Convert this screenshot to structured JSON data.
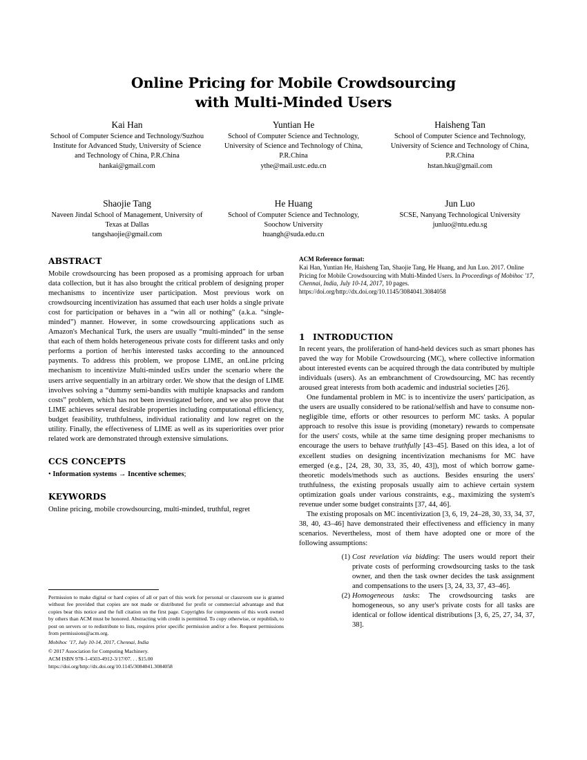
{
  "paper": {
    "title_lines": [
      "Online Pricing for Mobile Crowdsourcing",
      "with Multi-Minded Users"
    ],
    "authors_row1": [
      {
        "name": "Kai Han",
        "affiliation": "School of Computer Science and Technology/Suzhou Institute for Advanced Study, University of Science and Technology of China, P.R.China",
        "email": "hankai@gmail.com"
      },
      {
        "name": "Yuntian He",
        "affiliation": "School of Computer Science and Technology, University of Science and Technology of China, P.R.China",
        "email": "ythe@mail.ustc.edu.cn"
      },
      {
        "name": "Haisheng Tan",
        "affiliation": "School of Computer Science and Technology, University of Science and Technology of China, P.R.China",
        "email": "hstan.hku@gmail.com"
      }
    ],
    "authors_row2": [
      {
        "name": "Shaojie Tang",
        "affiliation": "Naveen Jindal School of Management, University of Texas at Dallas",
        "email": "tangshaojie@gmail.com"
      },
      {
        "name": "He Huang",
        "affiliation": "School of Computer Science and Technology, Soochow University",
        "email": "huangh@suda.edu.cn"
      },
      {
        "name": "Jun Luo",
        "affiliation": "SCSE, Nanyang Technological University",
        "email": "junluo@ntu.edu.sg"
      }
    ],
    "abstract": {
      "heading": "ABSTRACT",
      "text": "Mobile crowdsourcing has been proposed as a promising approach for urban data collection, but it has also brought the critical problem of designing proper mechanisms to incentivize user participation. Most previous work on crowdsourcing incentivization has assumed that each user holds a single private cost for participation or behaves in a “win all or nothing” (a.k.a. “single-minded”) manner. However, in some crowdsourcing applications such as Amazon's Mechanical Turk, the users are usually “multi-minded” in the sense that each of them holds heterogeneous private costs for different tasks and only performs a portion of her/his interested tasks according to the announced payments. To address this problem, we propose LIME, an onLine prIcing mechanism to incentivize Multi-minded usErs under the scenario where the users arrive sequentially in an arbitrary order. We show that the design of LIME involves solving a “dummy semi-bandits with multiple knapsacks and random costs” problem, which has not been investigated before, and we also prove that LIME achieves several desirable properties including computational efficiency, budget feasibility, truthfulness, individual rationality and low regret on the utility. Finally, the effectiveness of LIME as well as its superiorities over prior related work are demonstrated through extensive simulations."
    },
    "ccs": {
      "heading": "CCS CONCEPTS",
      "bullet": "•",
      "term1": "Information systems",
      "arrow": "→",
      "term2": "Incentive schemes",
      "trailing": ";"
    },
    "keywords": {
      "heading": "KEYWORDS",
      "text": "Online pricing, mobile crowdsourcing, multi-minded, truthful, regret"
    },
    "footnote": {
      "permission": "Permission to make digital or hard copies of all or part of this work for personal or classroom use is granted without fee provided that copies are not made or distributed for profit or commercial advantage and that copies bear this notice and the full citation on the first page. Copyrights for components of this work owned by others than ACM must be honored. Abstracting with credit is permitted. To copy otherwise, or republish, to post on servers or to redistribute to lists, requires prior specific permission and/or a fee. Request permissions from permissions@acm.org.",
      "conference": "Mobihoc ’17, July 10-14, 2017, Chennai, India",
      "copyright": "© 2017 Association for Computing Machinery.",
      "isbn": "ACM ISBN 978-1-4503-4912-3/17/07. . . $15.00",
      "doi": "https://doi.org/http://dx.doi.org/10.1145/3084041.3084058"
    },
    "acm_reference": {
      "heading": "ACM Reference format:",
      "line1": "Kai Han, Yuntian He, Haisheng Tan, Shaojie Tang, He Huang, and Jun Luo. 2017. Online Pricing for Mobile Crowdsourcing with Multi-Minded Users. In ",
      "italic_part": "Proceedings of Mobihoc '17, Chennai, India, July 10-14, 2017,",
      "line2": " 10 pages.",
      "doi": "https://doi.org/http://dx.doi.org/10.1145/3084041.3084058"
    },
    "introduction": {
      "number": "1",
      "heading": "INTRODUCTION",
      "para1": "In recent years, the proliferation of hand-held devices such as smart phones has paved the way for Mobile Crowdsourcing (MC), where collective information about interested events can be acquired through the data contributed by multiple individuals (users). As an embranchment of Crowdsourcing, MC has recently aroused great interests from both academic and industrial societies [26].",
      "para2_a": "One fundamental problem in MC is to incentivize the users' participation, as the users are usually considered to be rational/selfish and have to consume non-negligible time, efforts or other resources to perform MC tasks. A popular approach to resolve this issue is providing (monetary) rewards to compensate for the users' costs, while at the same time designing proper mechanisms to encourage the users to behave ",
      "para2_italic": "truthfully",
      "para2_b": " [43–45]. Based on this idea, a lot of excellent studies on designing incentivization mechanisms for MC have emerged (e.g., [24, 28, 30, 33, 35, 40, 43]), most of which borrow game-theoretic models/methods such as auctions. Besides ensuring the users' truthfulness, the existing proposals usually aim to achieve certain system optimization goals under various constraints, e.g., maximizing the system's revenue under some budget constraints [37, 44, 46].",
      "para3": "The existing proposals on MC incentivization [3, 6, 19, 24–28, 30, 33, 34, 37, 38, 40, 43–46] have demonstrated their effectiveness and efficiency in many scenarios. Nevertheless, most of them have adopted one or more of the following assumptions:",
      "assumptions": [
        {
          "mark": "(1)",
          "italic": "Cost revelation via bidding",
          "text": ": The users would report their private costs of performing crowdsourcing tasks to the task owner, and then the task owner decides the task assignment and compensations to the users [3, 24, 33, 37, 43–46]."
        },
        {
          "mark": "(2)",
          "italic": "Homogeneous tasks",
          "text": ": The crowdsourcing tasks are homogeneous, so any user's private costs for all tasks are identical or follow identical distributions [3, 6, 25, 27, 34, 37, 38]."
        }
      ]
    }
  }
}
